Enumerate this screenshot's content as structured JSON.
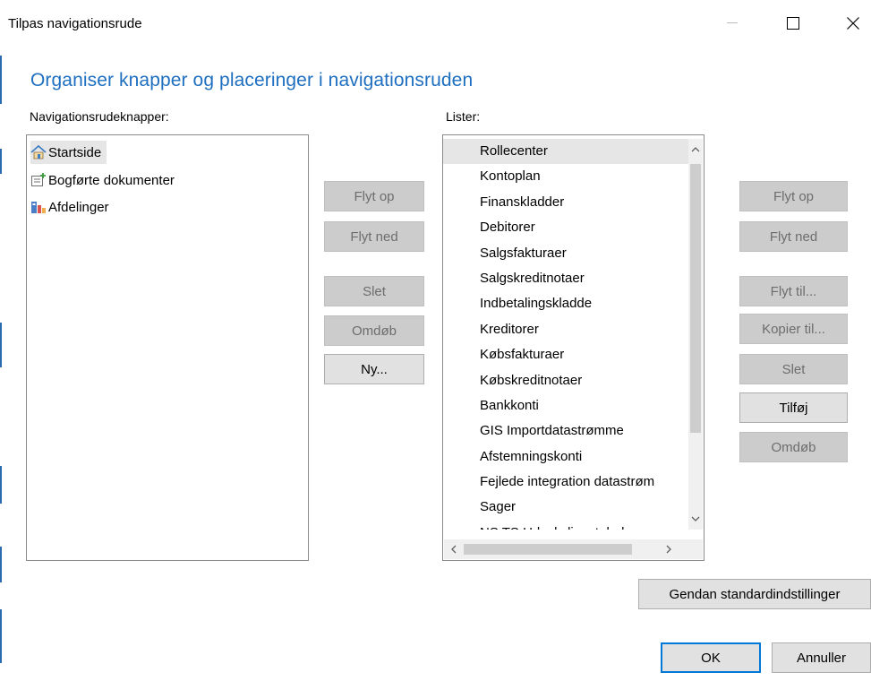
{
  "window": {
    "title": "Tilpas navigationsrude",
    "minimize_icon": "minimize-icon",
    "maximize_icon": "maximize-icon",
    "close_icon": "close-icon"
  },
  "heading": "Organiser knapper og placeringer i navigationsruden",
  "nav_pane": {
    "label": "Navigationsrudeknapper:",
    "items": [
      {
        "label": "Startside",
        "icon": "home-icon",
        "selected": true
      },
      {
        "label": "Bogførte dokumenter",
        "icon": "posted-documents-icon",
        "selected": false
      },
      {
        "label": "Afdelinger",
        "icon": "departments-icon",
        "selected": false
      }
    ],
    "buttons": {
      "move_up": "Flyt op",
      "move_down": "Flyt ned",
      "delete": "Slet",
      "rename": "Omdøb",
      "new": "Ny..."
    }
  },
  "lists": {
    "label": "Lister:",
    "items": [
      "Rollecenter",
      "Kontoplan",
      "Finanskladder",
      "Debitorer",
      "Salgsfakturaer",
      "Salgskreditnotaer",
      "Indbetalingskladde",
      "Kreditorer",
      "Købsfakturaer",
      "Købskreditnotaer",
      "Bankkonti",
      "GIS Importdatastrømme",
      "Afstemningskonti",
      "Fejlede integration datastrøm",
      "Sager",
      "NS TS Udvekslingstabel"
    ],
    "selected_index": 0,
    "buttons": {
      "move_up": "Flyt op",
      "move_down": "Flyt ned",
      "move_to": "Flyt til...",
      "copy_to": "Kopier til...",
      "delete": "Slet",
      "add": "Tilføj",
      "rename": "Omdøb"
    }
  },
  "footer": {
    "restore_defaults": "Gendan standardindstillinger",
    "ok": "OK",
    "cancel": "Annuller"
  },
  "colors": {
    "accent": "#1f6fc0",
    "default_button_border": "#0078d7",
    "disabled_button_bg": "#cccccc",
    "selection_bg": "#e6e6e6"
  }
}
